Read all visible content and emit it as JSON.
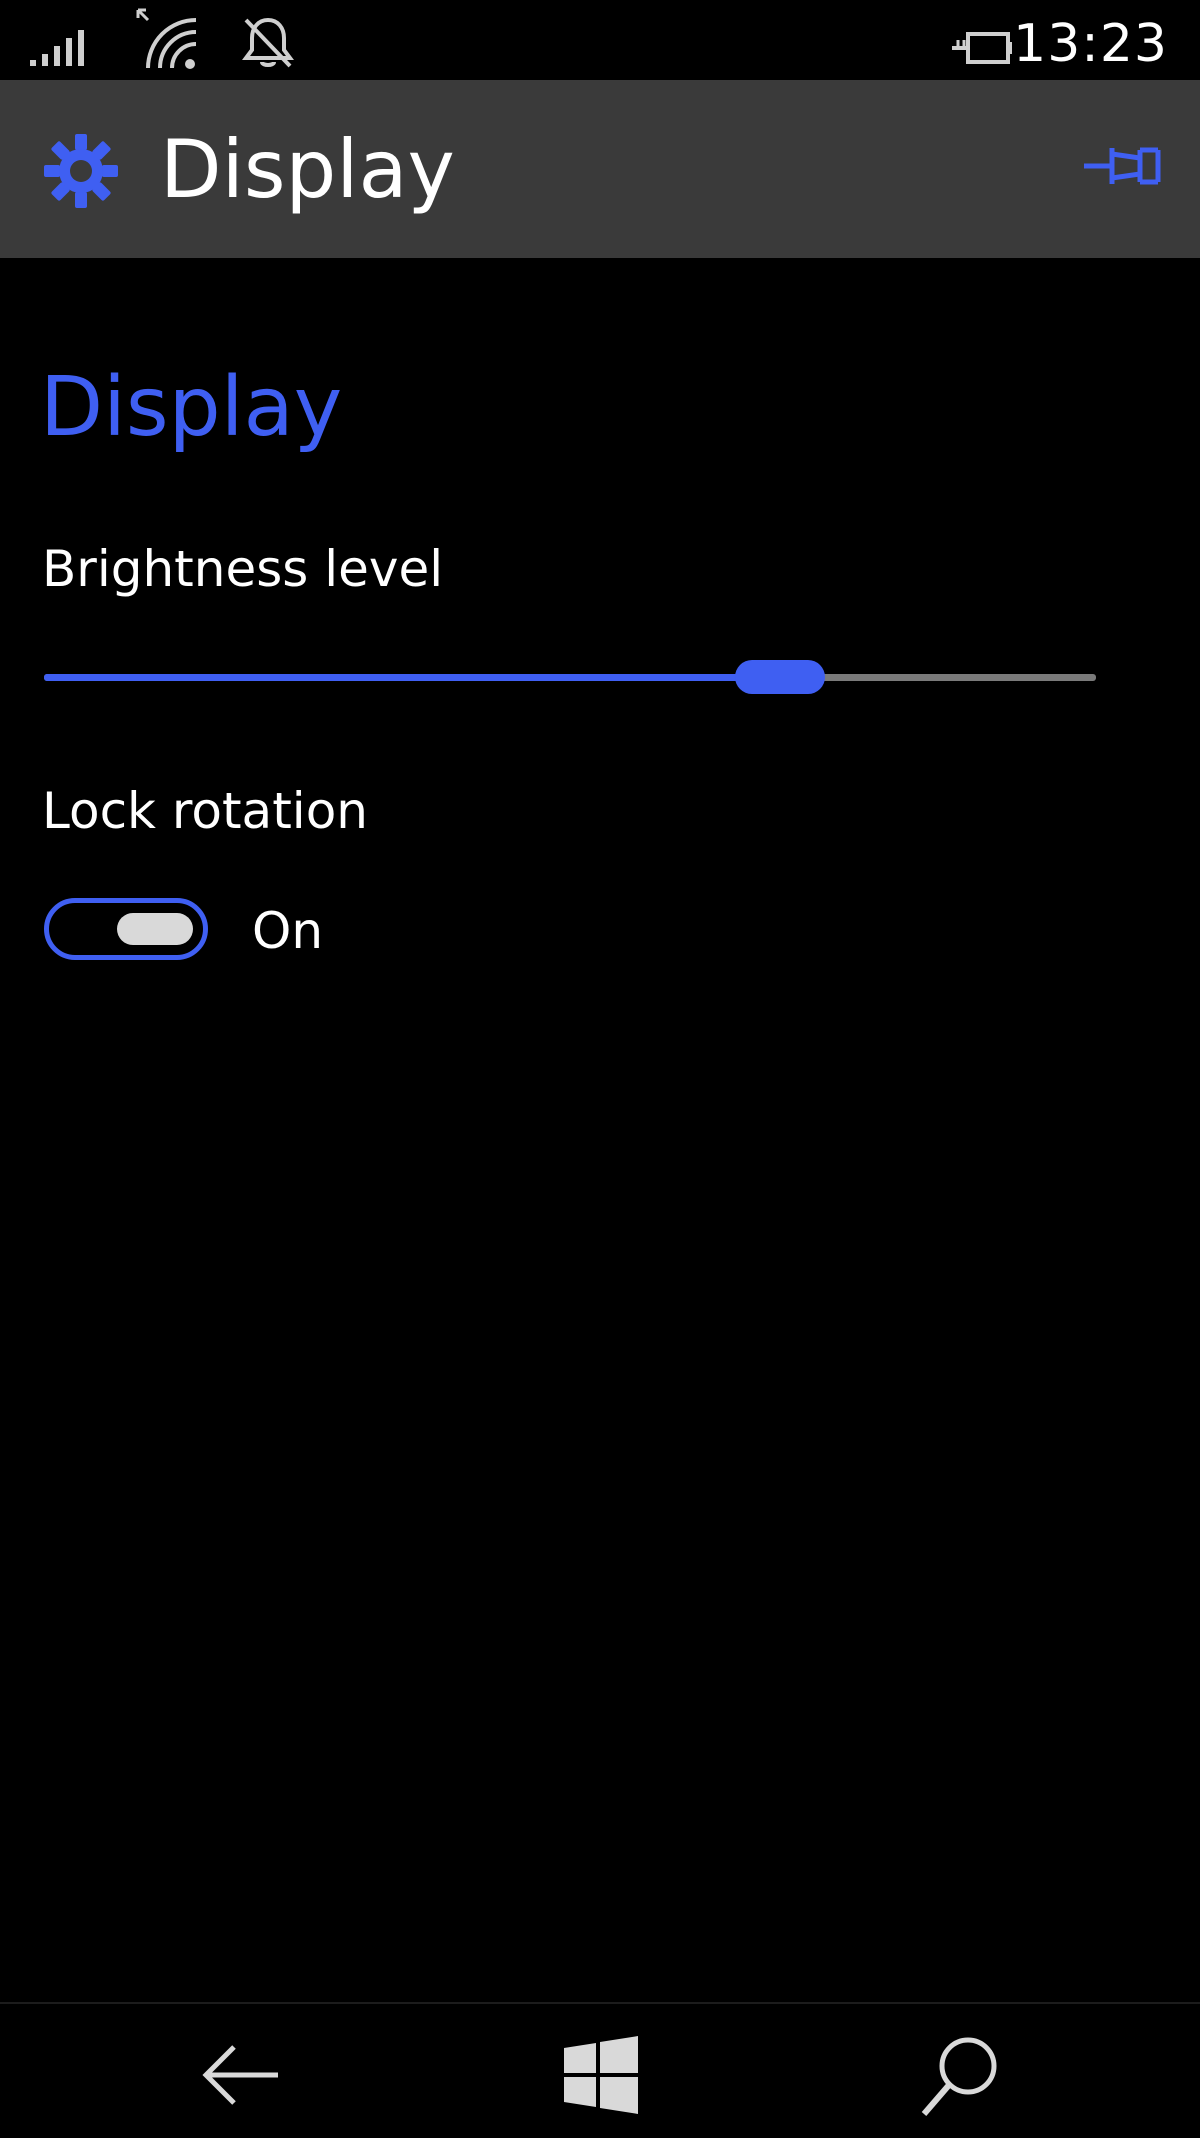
{
  "status_bar": {
    "time": "13:23",
    "icons": [
      "signal-strength-icon",
      "wifi-icon",
      "bell-off-icon",
      "battery-charging-icon"
    ]
  },
  "title_bar": {
    "icon": "gear-icon",
    "title": "Display",
    "pin_icon": "pin-icon"
  },
  "content": {
    "section_heading": "Display",
    "brightness": {
      "label": "Brightness level",
      "value_fraction": 0.7
    },
    "lock_rotation": {
      "label": "Lock rotation",
      "state": "On",
      "is_on": true
    }
  },
  "nav_bar": {
    "icons": [
      "back-arrow-icon",
      "windows-start-icon",
      "search-icon"
    ]
  },
  "colors": {
    "accent": "#3f5ff2",
    "title_bar_bg": "#3a3a3a",
    "background": "#000000",
    "text": "#ffffff",
    "track": "#7a7a7a"
  }
}
